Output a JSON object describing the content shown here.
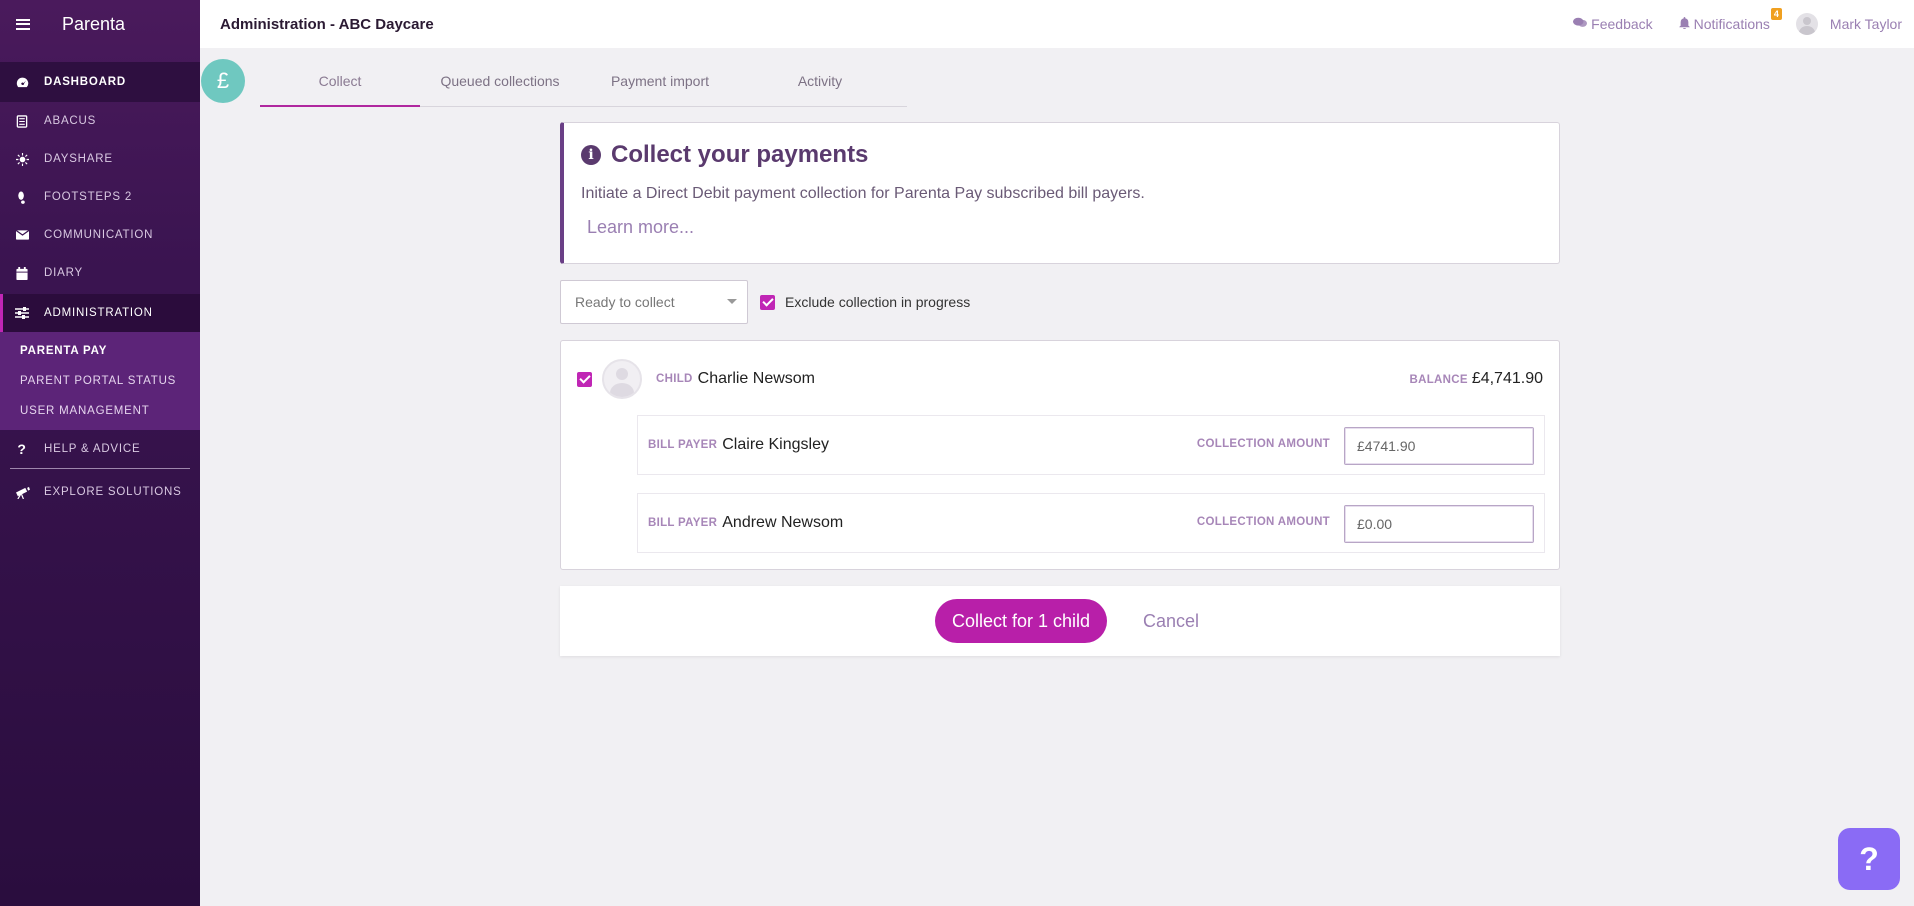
{
  "sidebar": {
    "brand": "Parenta",
    "items": [
      {
        "label": "DASHBOARD",
        "icon": "dashboard-icon"
      },
      {
        "label": "ABACUS",
        "icon": "abacus-icon"
      },
      {
        "label": "DAYSHARE",
        "icon": "sun-icon"
      },
      {
        "label": "FOOTSTEPS 2",
        "icon": "footsteps-icon"
      },
      {
        "label": "COMMUNICATION",
        "icon": "envelope-icon"
      },
      {
        "label": "DIARY",
        "icon": "calendar-icon"
      },
      {
        "label": "ADMINISTRATION",
        "icon": "sliders-icon"
      }
    ],
    "sub_items": [
      "PARENTA PAY",
      "PARENT PORTAL STATUS",
      "USER MANAGEMENT"
    ],
    "help": "HELP & ADVICE",
    "explore": "EXPLORE SOLUTIONS"
  },
  "header": {
    "title": "Administration - ABC Daycare",
    "feedback": "Feedback",
    "notifications": "Notifications",
    "notification_count": "4",
    "user": "Mark Taylor"
  },
  "pound_symbol": "£",
  "tabs": [
    "Collect",
    "Queued collections",
    "Payment import",
    "Activity"
  ],
  "info": {
    "title": "Collect your payments",
    "description": "Initiate a Direct Debit payment collection for Parenta Pay subscribed bill payers.",
    "learn_more": "Learn more..."
  },
  "filter": {
    "selected": "Ready to collect",
    "exclude_label": "Exclude collection in progress",
    "exclude_checked": true
  },
  "child": {
    "label": "CHILD",
    "name": "Charlie Newsom",
    "balance_label": "BALANCE",
    "balance": "£4,741.90",
    "checked": true,
    "payers": [
      {
        "label": "BILL PAYER",
        "name": "Claire Kingsley",
        "amount_label": "COLLECTION AMOUNT",
        "amount": "£4741.90"
      },
      {
        "label": "BILL PAYER",
        "name": "Andrew Newsom",
        "amount_label": "COLLECTION AMOUNT",
        "amount": "£0.00"
      }
    ]
  },
  "actions": {
    "collect": "Collect for 1 child",
    "cancel": "Cancel"
  },
  "help_button": "?",
  "colors": {
    "sidebar": "#3a1450",
    "accent": "#b81fa9",
    "link": "#9a7fb2",
    "badge": "#6fc8c0"
  }
}
